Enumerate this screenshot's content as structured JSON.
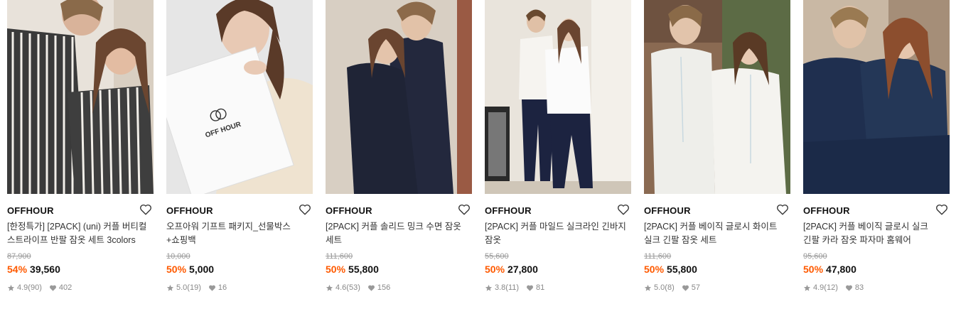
{
  "products": [
    {
      "brand": "OFFHOUR",
      "title": "[한정특가] [2PACK] (uni) 커플 버티컬 스트라이프 반팔 잠옷 세트 3colors",
      "original_price": "87,900",
      "discount": "54%",
      "price": "39,560",
      "rating": "4.9",
      "reviews": "(90)",
      "likes": "402",
      "image": "couple-stripe-pajama-photo"
    },
    {
      "brand": "OFFHOUR",
      "title": "오프아워 기프트 패키지_선물박스+쇼핑백",
      "original_price": "10,000",
      "discount": "50%",
      "price": "5,000",
      "rating": "5.0",
      "reviews": "(19)",
      "likes": "16",
      "image": "gift-box-photo",
      "box_logo": "OFF HOUR"
    },
    {
      "brand": "OFFHOUR",
      "title": "[2PACK] 커플 솔리드 밍크 수면 잠옷 세트",
      "original_price": "111,600",
      "discount": "50%",
      "price": "55,800",
      "rating": "4.6",
      "reviews": "(53)",
      "likes": "156",
      "image": "navy-mink-pajama-photo"
    },
    {
      "brand": "OFFHOUR",
      "title": "[2PACK] 커플 마일드 실크라인 긴바지 잠옷",
      "original_price": "55,600",
      "discount": "50%",
      "price": "27,800",
      "rating": "3.8",
      "reviews": "(11)",
      "likes": "81",
      "image": "white-navy-pajama-photo"
    },
    {
      "brand": "OFFHOUR",
      "title": "[2PACK] 커플 베이직 글로시 화이트 실크 긴팔 잠옷 세트",
      "original_price": "111,600",
      "discount": "50%",
      "price": "55,800",
      "rating": "5.0",
      "reviews": "(8)",
      "likes": "57",
      "image": "white-silk-pajama-photo"
    },
    {
      "brand": "OFFHOUR",
      "title": "[2PACK] 커플 베이직 글로시 실크 긴팔 카라 잠옷 파자마 홈웨어",
      "original_price": "95,600",
      "discount": "50%",
      "price": "47,800",
      "rating": "4.9",
      "reviews": "(12)",
      "likes": "83",
      "image": "navy-silk-pajama-photo"
    }
  ],
  "colors": {
    "discount": "#ff5a00",
    "meta": "#888888",
    "original": "#999999"
  },
  "icons": [
    "heart-outline-icon",
    "star-icon",
    "heart-filled-icon"
  ]
}
